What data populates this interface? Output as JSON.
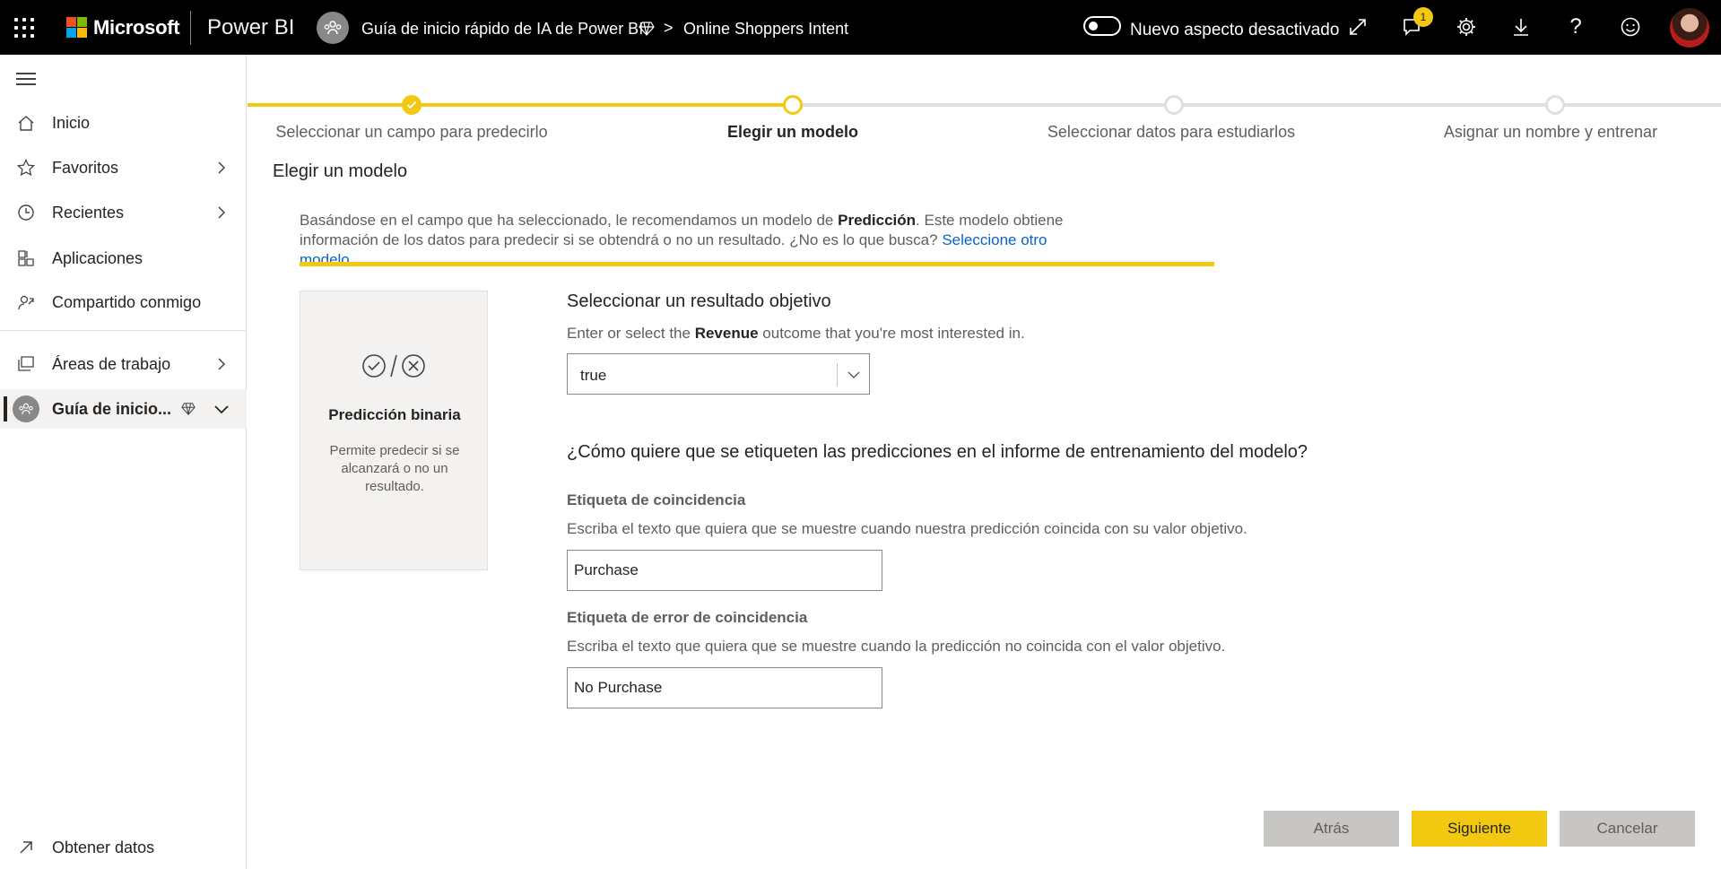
{
  "header": {
    "brand": "Microsoft",
    "product": "Power BI",
    "workspace": "Guía de inicio rápido de IA de Power BI",
    "dataflow": "Online Shoppers Intent",
    "new_look_label": "Nuevo aspecto desactivado",
    "notification_count": "1",
    "accent_color": "#f2c811"
  },
  "sidebar": {
    "items": [
      {
        "label": "Inicio",
        "icon": "home-icon"
      },
      {
        "label": "Favoritos",
        "icon": "star-icon"
      },
      {
        "label": "Recientes",
        "icon": "clock-icon"
      },
      {
        "label": "Aplicaciones",
        "icon": "apps-icon"
      },
      {
        "label": "Compartido conmigo",
        "icon": "shared-icon"
      },
      {
        "label": "Áreas de trabajo",
        "icon": "workspaces-icon"
      },
      {
        "label": "Guía de inicio...",
        "icon": "workspace-avatar-icon"
      }
    ],
    "get_data": "Obtener datos"
  },
  "stepper": {
    "steps": [
      {
        "label": "Seleccionar un campo para predecirlo",
        "state": "done"
      },
      {
        "label": "Elegir un modelo",
        "state": "current"
      },
      {
        "label": "Seleccionar datos para estudiarlos",
        "state": "pending"
      },
      {
        "label": "Asignar un nombre y entrenar",
        "state": "pending"
      }
    ]
  },
  "main": {
    "title": "Elegir un modelo",
    "info_part1": "Basándose en el campo que ha seleccionado, le recomendamos un modelo de ",
    "info_bold": "Predicción",
    "info_part2": ". Este modelo obtiene información de los datos para predecir si se obtendrá o no un resultado. ¿No es lo que busca? ",
    "info_link": "Seleccione otro modelo",
    "model_card": {
      "title": "Predicción binaria",
      "description": "Permite predecir si se alcanzará o no un resultado."
    },
    "target": {
      "heading": "Seleccionar un resultado objetivo",
      "sub_part1": "Enter or select the ",
      "sub_bold": "Revenue",
      "sub_part2": " outcome that you're most interested in.",
      "value": "true"
    },
    "labels_heading": "¿Cómo quiere que se etiqueten las predicciones en el informe de entrenamiento del modelo?",
    "match": {
      "heading": "Etiqueta de coincidencia",
      "description": "Escriba el texto que quiera que se muestre cuando nuestra predicción coincida con su valor objetivo.",
      "value": "Purchase"
    },
    "mismatch": {
      "heading": "Etiqueta de error de coincidencia",
      "description": "Escriba el texto que quiera que se muestre cuando la predicción no coincida con el valor objetivo.",
      "value": "No Purchase"
    }
  },
  "footer": {
    "back": "Atrás",
    "next": "Siguiente",
    "cancel": "Cancelar"
  }
}
